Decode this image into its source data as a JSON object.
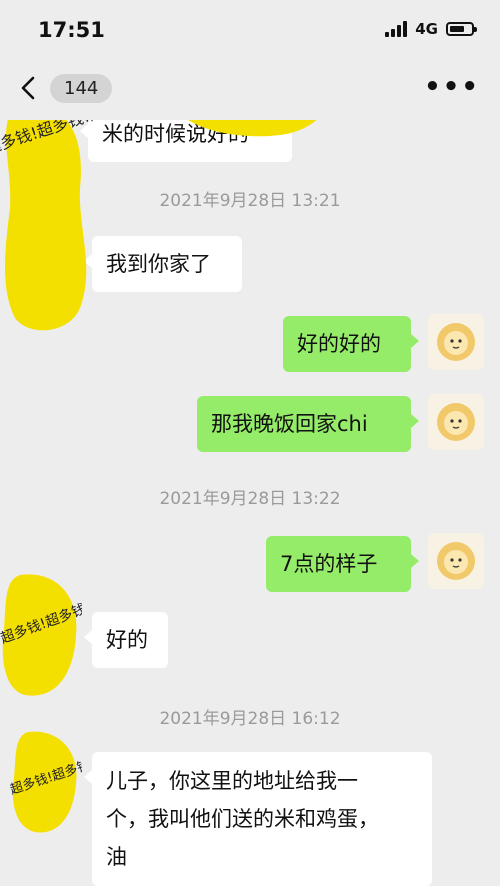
{
  "status_bar": {
    "time": "17:51",
    "network": "4G"
  },
  "nav": {
    "unread_count": "144"
  },
  "stickers": {
    "text": "超多钱!超多钱!超多钱!超多钱!超多钱!超多钱!"
  },
  "messages": [
    {
      "type": "in",
      "text": "米的时候说好的"
    },
    {
      "type": "timestamp",
      "text": "2021年9月28日 13:21"
    },
    {
      "type": "in",
      "text": "我到你家了"
    },
    {
      "type": "out",
      "text": "好的好的"
    },
    {
      "type": "out",
      "text": "那我晚饭回家chi"
    },
    {
      "type": "timestamp",
      "text": "2021年9月28日 13:22"
    },
    {
      "type": "out",
      "text": "7点的样子"
    },
    {
      "type": "in",
      "text": "好的"
    },
    {
      "type": "timestamp",
      "text": "2021年9月28日 16:12"
    },
    {
      "type": "in",
      "lines": [
        "儿子，你这里的地址给我一",
        "个，我叫他们送的米和鸡蛋，",
        "油"
      ]
    }
  ],
  "colors": {
    "background": "#ededed",
    "outgoing_bubble": "#95ec69",
    "incoming_bubble": "#ffffff",
    "timestamp": "#9a9a9a",
    "sticker": "#f4e000"
  }
}
